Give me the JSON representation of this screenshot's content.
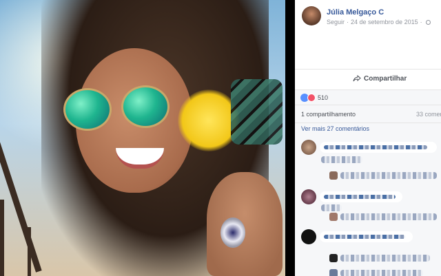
{
  "post": {
    "author": "Júlia Melgaço C",
    "follow": "Seguir",
    "separator": "·",
    "date": "24 de setembro de 2015",
    "privacy_icon": "globe-icon"
  },
  "actions": {
    "share_label": "Compartilhar",
    "share_icon": "share-arrow-icon"
  },
  "reactions": {
    "count": "510",
    "icons": [
      "like-icon",
      "love-icon"
    ],
    "like_color": "#5890ff",
    "love_color": "#f25268"
  },
  "stats": {
    "shares": "1 compartilhamento",
    "comments": "33 comen"
  },
  "comments": {
    "more_link": "Ver mais 27 comentários"
  },
  "colors": {
    "link_blue": "#365899",
    "panel_bg": "#f6f7f9",
    "meta_grey": "#90949c"
  }
}
